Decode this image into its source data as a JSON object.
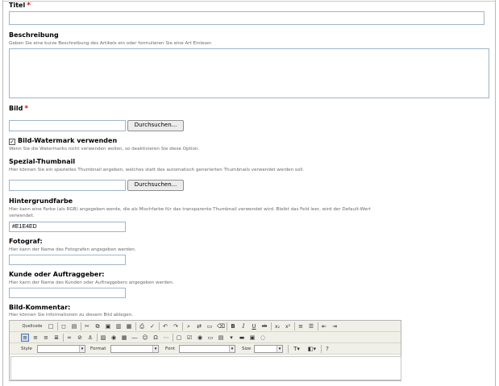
{
  "fields": {
    "titel": {
      "label": "Titel",
      "required": "*",
      "value": ""
    },
    "beschreibung": {
      "label": "Beschreibung",
      "hint": "Geben Sie eine kurze Beschreibung des Artikels ein oder formulieren Sie eine Art Einleser.",
      "value": ""
    },
    "bild": {
      "label": "Bild",
      "required": "*",
      "value": "",
      "browse_label": "Durchsuchen..."
    },
    "watermark": {
      "label": "Bild-Watermark verwenden",
      "checked": true,
      "check_glyph": "✓",
      "hint": "Wenn Sie die Watermarks nicht verwenden wollen, so deaktivieren Sie diese Option."
    },
    "spezial_thumbnail": {
      "label": "Spezial-Thumbnail",
      "hint": "Hier können Sie ein spezielles Thumbnail angeben, welches statt des automatisch generierten Thumbnails verwendet werden soll.",
      "value": "",
      "browse_label": "Durchsuchen..."
    },
    "hintergrundfarbe": {
      "label": "Hintergrundfarbe",
      "hint_line1": "Hier kann eine Farbe (als RGB) angegeben werde, die als Mischfarbe für das transparente Thumbnail verwendet wird. Bleibt das Feld leer, wird der Default-Wert",
      "hint_line2": "verwendet.",
      "value": "#E1E4ED"
    },
    "fotograf": {
      "label": "Fotograf:",
      "hint": "Hier kann der Name des Fotografen angegeben werden.",
      "value": ""
    },
    "kunde": {
      "label": "Kunde oder Auftraggeber:",
      "hint": "Hier kann der Name des Kunden oder Auftraggebers angegeben werden.",
      "value": ""
    },
    "kommentar": {
      "label": "Bild-Kommentar:",
      "hint": "Hier können Sie Informationen zu diesem Bild ablegen."
    }
  },
  "editor": {
    "source_label": "Quellcode",
    "style_label": "Style",
    "format_label": "Format",
    "font_label": "Font",
    "size_label": "Size",
    "content": ""
  },
  "colors": {
    "required": "#d01010",
    "input_border": "#9db6cc",
    "toolbar_bg": "#f0efe8",
    "active_button": "#cfdef4"
  }
}
